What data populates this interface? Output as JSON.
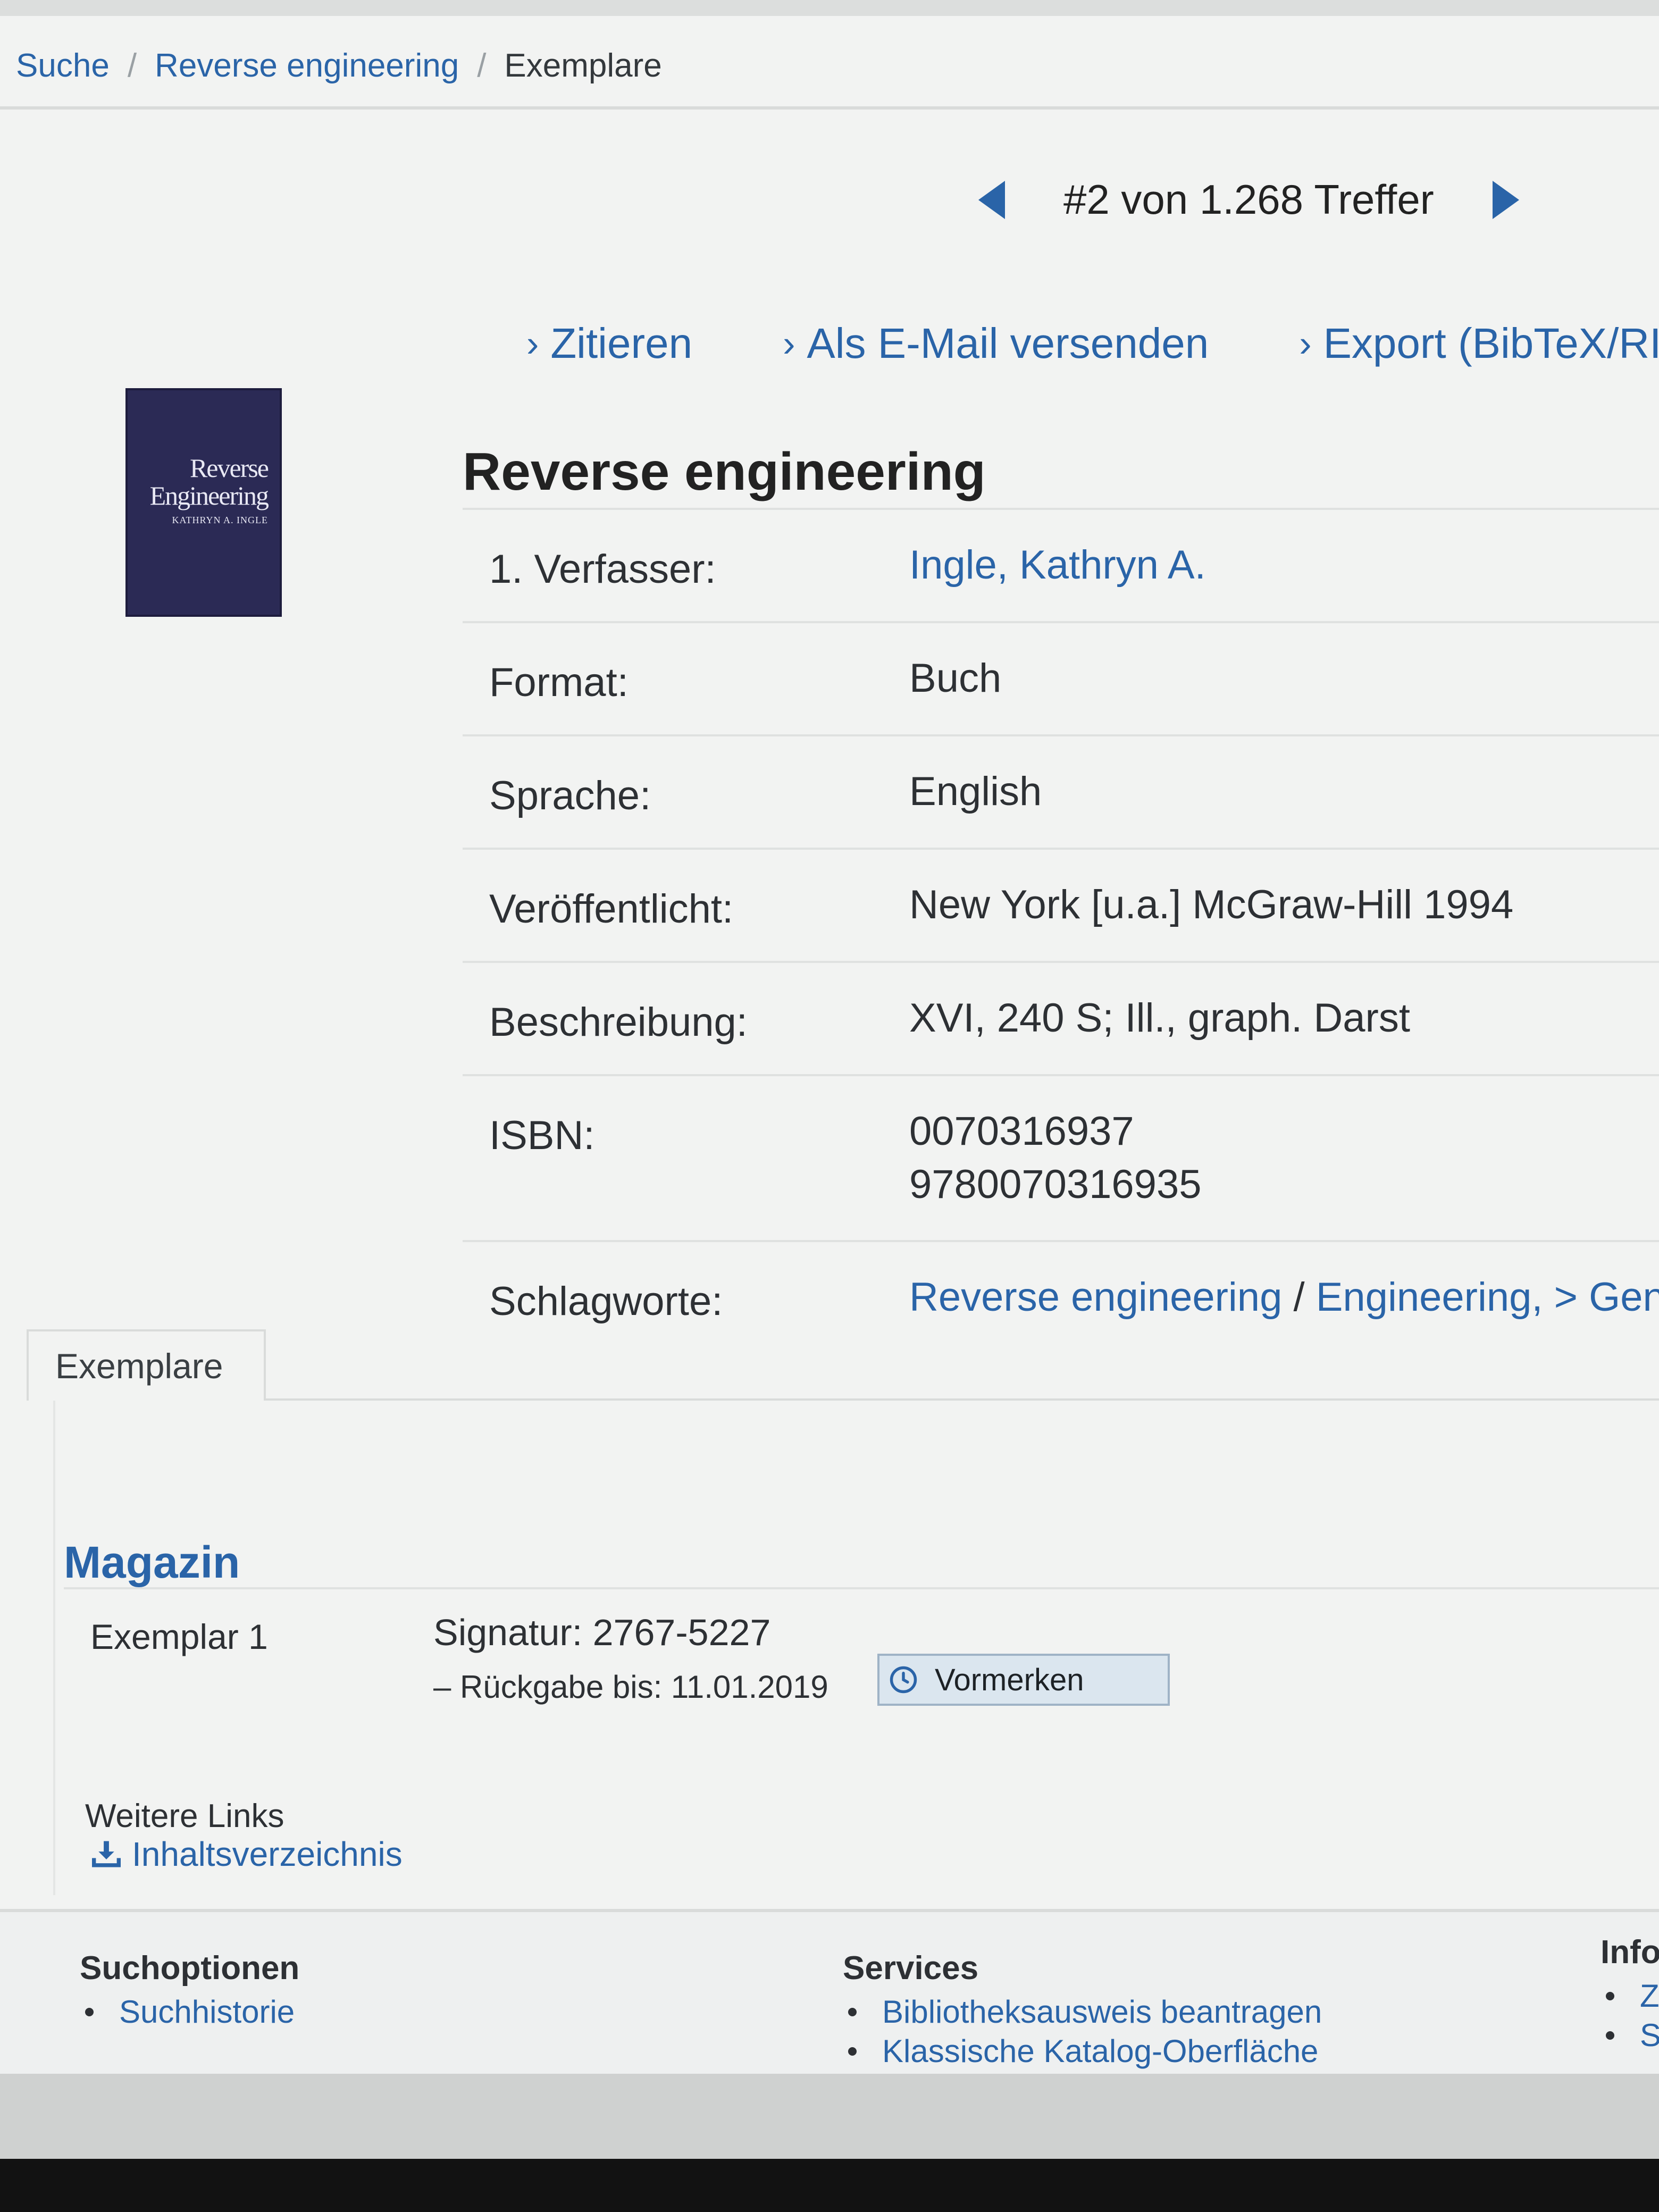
{
  "breadcrumb": {
    "items": [
      "Suche",
      "Reverse engineering",
      "Exemplare"
    ],
    "separator": "/"
  },
  "pager": {
    "text": "#2 von 1.268 Treffer"
  },
  "actions": {
    "cite": "Zitieren",
    "email": "Als E-Mail versenden",
    "export": "Export (BibTeX/RI"
  },
  "cover": {
    "line1": "Reverse",
    "line2": "Engineering",
    "line3": "KATHRYN A. INGLE"
  },
  "record": {
    "title": "Reverse engineering",
    "author_label": "1. Verfasser:",
    "author": "Ingle, Kathryn A.",
    "format_label": "Format:",
    "format": "Buch",
    "language_label": "Sprache:",
    "language": "English",
    "published_label": "Veröffentlicht:",
    "published": "New York [u.a.] McGraw-Hill 1994",
    "description_label": "Beschreibung:",
    "description": "XVI, 240 S; Ill., graph. Darst",
    "isbn_label": "ISBN:",
    "isbn": [
      "0070316937",
      "9780070316935"
    ],
    "subjects_label": "Schlagworte:",
    "subjects": [
      "Reverse engineering",
      "Engineering,",
      "> Gener"
    ],
    "subject_separator": "/"
  },
  "holdings": {
    "tab_label": "Exemplare",
    "location": "Magazin",
    "item_label": "Exemplar 1",
    "signature": "Signatur: 2767-5227",
    "return_date": "– Rückgabe bis: 11.01.2019",
    "reserve_button": "Vormerken",
    "more_links_label": "Weitere Links",
    "toc_link": "Inhaltsverzeichnis"
  },
  "footer": {
    "search_options": {
      "heading": "Suchoptionen",
      "items": [
        "Suchhistorie"
      ]
    },
    "services": {
      "heading": "Services",
      "items": [
        "Bibliotheksausweis beantragen",
        "Klassische Katalog-Oberfläche"
      ]
    },
    "info": {
      "heading": "Info",
      "items": [
        "Z",
        "S"
      ]
    }
  },
  "colors": {
    "link": "#2a64a8",
    "text": "#2d3034",
    "background": "#f2f3f2",
    "button_bg": "#dbe6ef"
  }
}
